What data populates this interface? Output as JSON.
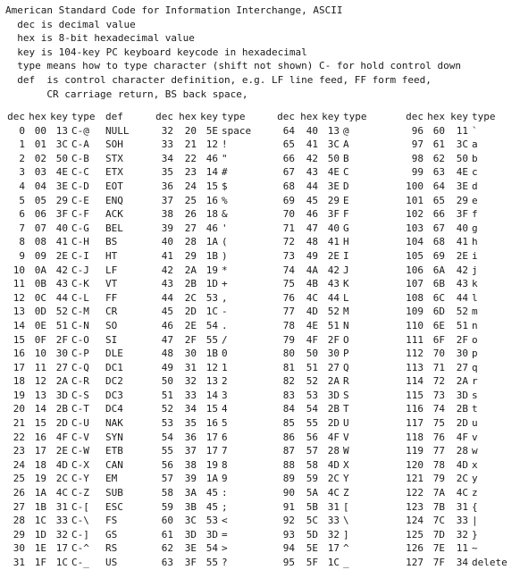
{
  "intro_lines": [
    "American Standard Code for Information Interchange, ASCII",
    "  dec is decimal value",
    "  hex is 8-bit hexadecimal value",
    "  key is 104-key PC keyboard keycode in hexadecimal",
    "  type means how to type character (shift not shown) C- for hold control down",
    "  def  is control character definition, e.g. LF line feed, FF form feed,",
    "       CR carriage return, BS back space,"
  ],
  "headers": {
    "dec": "dec",
    "hex": "hex",
    "key": "key",
    "type": "type",
    "def": "def"
  },
  "columns": [
    {
      "show_def": true,
      "rows": [
        [
          "0",
          "00",
          "13",
          "C-@",
          "NULL"
        ],
        [
          "1",
          "01",
          "3C",
          "C-A",
          "SOH"
        ],
        [
          "2",
          "02",
          "50",
          "C-B",
          "STX"
        ],
        [
          "3",
          "03",
          "4E",
          "C-C",
          "ETX"
        ],
        [
          "4",
          "04",
          "3E",
          "C-D",
          "EOT"
        ],
        [
          "5",
          "05",
          "29",
          "C-E",
          "ENQ"
        ],
        [
          "6",
          "06",
          "3F",
          "C-F",
          "ACK"
        ],
        [
          "7",
          "07",
          "40",
          "C-G",
          "BEL"
        ],
        [
          "8",
          "08",
          "41",
          "C-H",
          "BS"
        ],
        [
          "9",
          "09",
          "2E",
          "C-I",
          "HT"
        ],
        [
          "10",
          "0A",
          "42",
          "C-J",
          "LF"
        ],
        [
          "11",
          "0B",
          "43",
          "C-K",
          "VT"
        ],
        [
          "12",
          "0C",
          "44",
          "C-L",
          "FF"
        ],
        [
          "13",
          "0D",
          "52",
          "C-M",
          "CR"
        ],
        [
          "14",
          "0E",
          "51",
          "C-N",
          "SO"
        ],
        [
          "15",
          "0F",
          "2F",
          "C-O",
          "SI"
        ],
        [
          "16",
          "10",
          "30",
          "C-P",
          "DLE"
        ],
        [
          "17",
          "11",
          "27",
          "C-Q",
          "DC1"
        ],
        [
          "18",
          "12",
          "2A",
          "C-R",
          "DC2"
        ],
        [
          "19",
          "13",
          "3D",
          "C-S",
          "DC3"
        ],
        [
          "20",
          "14",
          "2B",
          "C-T",
          "DC4"
        ],
        [
          "21",
          "15",
          "2D",
          "C-U",
          "NAK"
        ],
        [
          "22",
          "16",
          "4F",
          "C-V",
          "SYN"
        ],
        [
          "23",
          "17",
          "2E",
          "C-W",
          "ETB"
        ],
        [
          "24",
          "18",
          "4D",
          "C-X",
          "CAN"
        ],
        [
          "25",
          "19",
          "2C",
          "C-Y",
          "EM"
        ],
        [
          "26",
          "1A",
          "4C",
          "C-Z",
          "SUB"
        ],
        [
          "27",
          "1B",
          "31",
          "C-[",
          "ESC"
        ],
        [
          "28",
          "1C",
          "33",
          "C-\\",
          "FS"
        ],
        [
          "29",
          "1D",
          "32",
          "C-]",
          "GS"
        ],
        [
          "30",
          "1E",
          "17",
          "C-^",
          "RS"
        ],
        [
          "31",
          "1F",
          "1C",
          "C-_",
          "US"
        ]
      ]
    },
    {
      "show_def": false,
      "rows": [
        [
          "32",
          "20",
          "5E",
          "space"
        ],
        [
          "33",
          "21",
          "12",
          "!"
        ],
        [
          "34",
          "22",
          "46",
          "\""
        ],
        [
          "35",
          "23",
          "14",
          "#"
        ],
        [
          "36",
          "24",
          "15",
          "$"
        ],
        [
          "37",
          "25",
          "16",
          "%"
        ],
        [
          "38",
          "26",
          "18",
          "&"
        ],
        [
          "39",
          "27",
          "46",
          "'"
        ],
        [
          "40",
          "28",
          "1A",
          "("
        ],
        [
          "41",
          "29",
          "1B",
          ")"
        ],
        [
          "42",
          "2A",
          "19",
          "*"
        ],
        [
          "43",
          "2B",
          "1D",
          "+"
        ],
        [
          "44",
          "2C",
          "53",
          ","
        ],
        [
          "45",
          "2D",
          "1C",
          "-"
        ],
        [
          "46",
          "2E",
          "54",
          "."
        ],
        [
          "47",
          "2F",
          "55",
          "/"
        ],
        [
          "48",
          "30",
          "1B",
          "0"
        ],
        [
          "49",
          "31",
          "12",
          "1"
        ],
        [
          "50",
          "32",
          "13",
          "2"
        ],
        [
          "51",
          "33",
          "14",
          "3"
        ],
        [
          "52",
          "34",
          "15",
          "4"
        ],
        [
          "53",
          "35",
          "16",
          "5"
        ],
        [
          "54",
          "36",
          "17",
          "6"
        ],
        [
          "55",
          "37",
          "17",
          "7"
        ],
        [
          "56",
          "38",
          "19",
          "8"
        ],
        [
          "57",
          "39",
          "1A",
          "9"
        ],
        [
          "58",
          "3A",
          "45",
          ":"
        ],
        [
          "59",
          "3B",
          "45",
          ";"
        ],
        [
          "60",
          "3C",
          "53",
          "<"
        ],
        [
          "61",
          "3D",
          "3D",
          "="
        ],
        [
          "62",
          "3E",
          "54",
          ">"
        ],
        [
          "63",
          "3F",
          "55",
          "?"
        ]
      ]
    },
    {
      "show_def": false,
      "rows": [
        [
          "64",
          "40",
          "13",
          "@"
        ],
        [
          "65",
          "41",
          "3C",
          "A"
        ],
        [
          "66",
          "42",
          "50",
          "B"
        ],
        [
          "67",
          "43",
          "4E",
          "C"
        ],
        [
          "68",
          "44",
          "3E",
          "D"
        ],
        [
          "69",
          "45",
          "29",
          "E"
        ],
        [
          "70",
          "46",
          "3F",
          "F"
        ],
        [
          "71",
          "47",
          "40",
          "G"
        ],
        [
          "72",
          "48",
          "41",
          "H"
        ],
        [
          "73",
          "49",
          "2E",
          "I"
        ],
        [
          "74",
          "4A",
          "42",
          "J"
        ],
        [
          "75",
          "4B",
          "43",
          "K"
        ],
        [
          "76",
          "4C",
          "44",
          "L"
        ],
        [
          "77",
          "4D",
          "52",
          "M"
        ],
        [
          "78",
          "4E",
          "51",
          "N"
        ],
        [
          "79",
          "4F",
          "2F",
          "O"
        ],
        [
          "80",
          "50",
          "30",
          "P"
        ],
        [
          "81",
          "51",
          "27",
          "Q"
        ],
        [
          "82",
          "52",
          "2A",
          "R"
        ],
        [
          "83",
          "53",
          "3D",
          "S"
        ],
        [
          "84",
          "54",
          "2B",
          "T"
        ],
        [
          "85",
          "55",
          "2D",
          "U"
        ],
        [
          "86",
          "56",
          "4F",
          "V"
        ],
        [
          "87",
          "57",
          "28",
          "W"
        ],
        [
          "88",
          "58",
          "4D",
          "X"
        ],
        [
          "89",
          "59",
          "2C",
          "Y"
        ],
        [
          "90",
          "5A",
          "4C",
          "Z"
        ],
        [
          "91",
          "5B",
          "31",
          "["
        ],
        [
          "92",
          "5C",
          "33",
          "\\"
        ],
        [
          "93",
          "5D",
          "32",
          "]"
        ],
        [
          "94",
          "5E",
          "17",
          "^"
        ],
        [
          "95",
          "5F",
          "1C",
          "_"
        ]
      ]
    },
    {
      "show_def": false,
      "rows": [
        [
          "96",
          "60",
          "11",
          "`"
        ],
        [
          "97",
          "61",
          "3C",
          "a"
        ],
        [
          "98",
          "62",
          "50",
          "b"
        ],
        [
          "99",
          "63",
          "4E",
          "c"
        ],
        [
          "100",
          "64",
          "3E",
          "d"
        ],
        [
          "101",
          "65",
          "29",
          "e"
        ],
        [
          "102",
          "66",
          "3F",
          "f"
        ],
        [
          "103",
          "67",
          "40",
          "g"
        ],
        [
          "104",
          "68",
          "41",
          "h"
        ],
        [
          "105",
          "69",
          "2E",
          "i"
        ],
        [
          "106",
          "6A",
          "42",
          "j"
        ],
        [
          "107",
          "6B",
          "43",
          "k"
        ],
        [
          "108",
          "6C",
          "44",
          "l"
        ],
        [
          "109",
          "6D",
          "52",
          "m"
        ],
        [
          "110",
          "6E",
          "51",
          "n"
        ],
        [
          "111",
          "6F",
          "2F",
          "o"
        ],
        [
          "112",
          "70",
          "30",
          "p"
        ],
        [
          "113",
          "71",
          "27",
          "q"
        ],
        [
          "114",
          "72",
          "2A",
          "r"
        ],
        [
          "115",
          "73",
          "3D",
          "s"
        ],
        [
          "116",
          "74",
          "2B",
          "t"
        ],
        [
          "117",
          "75",
          "2D",
          "u"
        ],
        [
          "118",
          "76",
          "4F",
          "v"
        ],
        [
          "119",
          "77",
          "28",
          "w"
        ],
        [
          "120",
          "78",
          "4D",
          "x"
        ],
        [
          "121",
          "79",
          "2C",
          "y"
        ],
        [
          "122",
          "7A",
          "4C",
          "z"
        ],
        [
          "123",
          "7B",
          "31",
          "{"
        ],
        [
          "124",
          "7C",
          "33",
          "|"
        ],
        [
          "125",
          "7D",
          "32",
          "}"
        ],
        [
          "126",
          "7E",
          "11",
          "~"
        ],
        [
          "127",
          "7F",
          "34",
          "delete"
        ]
      ]
    }
  ]
}
